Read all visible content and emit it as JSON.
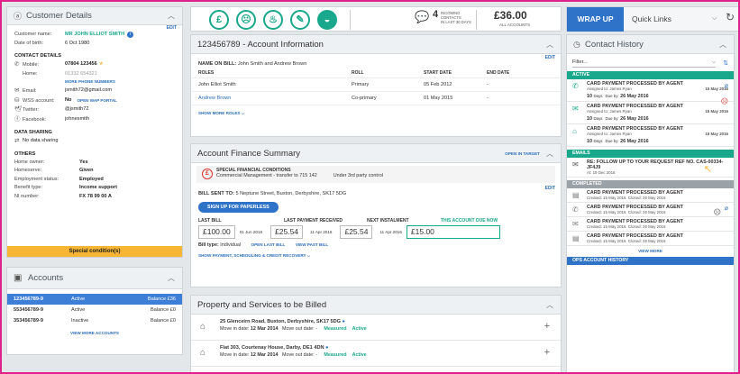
{
  "customer": {
    "title": "Customer Details",
    "edit": "EDIT",
    "name_label": "Customer name:",
    "name": "MR JOHN ELLIOT SMITH",
    "dob_label": "Date of birth:",
    "dob": "6 Oct 1980",
    "contact_title": "CONTACT DETAILS",
    "mobile_label": "Mobile:",
    "mobile": "07804 123456",
    "home_label": "Home:",
    "home": "01332 654321",
    "more_phone": "MORE PHONE NUMBERS",
    "email_label": "Email:",
    "email": "jsmith72@gmail.com",
    "wss_label": "WSS account:",
    "wss": "No",
    "wap_portal": "OPEN WAP PORTAL",
    "twitter_label": "Twitter:",
    "twitter": "@jsmith72",
    "facebook_label": "Facebook:",
    "facebook": "johnesmith",
    "sharing_title": "DATA SHARING",
    "sharing": "No data sharing",
    "others_title": "OTHERS",
    "homeowner_label": "Home owner:",
    "homeowner": "Yes",
    "homeserve_label": "Homeserve:",
    "homeserve": "Given",
    "employment_label": "Employment status:",
    "employment": "Employed",
    "benefit_label": "Benefit type:",
    "benefit": "Income support",
    "ni_label": "NI number:",
    "ni": "FX 78 99 00 A",
    "special": "Special condition(s)"
  },
  "accounts": {
    "title": "Accounts",
    "rows": [
      {
        "num": "123456789-9",
        "status": "Active",
        "balance": "Balance £36"
      },
      {
        "num": "553456789-9",
        "status": "Active",
        "balance": "Balance £0"
      },
      {
        "num": "353456789-9",
        "status": "Inactive",
        "balance": "Balance £0"
      }
    ],
    "view_more": "VIEW MORE ACCOUNTS"
  },
  "topbar": {
    "incoming_count": "4",
    "incoming_l1": "INCOMING",
    "incoming_l2": "CONTACTS",
    "incoming_l3": "IN LAST 30 DAYS",
    "amount": "£36.00",
    "amount_label": "ALL ACCOUNTS"
  },
  "wrap": {
    "wrap_up": "WRAP UP",
    "quick_links": "Quick Links"
  },
  "acct_info": {
    "title": "123456789 - Account Information",
    "edit": "EDIT",
    "name_on_bill_label": "NAME ON BILL:",
    "name_on_bill": "John Smith and Andrew Brown",
    "headers": [
      "ROLES",
      "ROLL",
      "START DATE",
      "END DATE"
    ],
    "rows": [
      [
        "John Elliot Smith",
        "Primary",
        "05 Feb 2012",
        "-"
      ],
      [
        "Andrew Brown",
        "Co-primary",
        "01 May 2015",
        "-"
      ]
    ],
    "show_more": "SHOW MORE ROLES"
  },
  "finance": {
    "title": "Account Finance Summary",
    "open_target": "OPEN IN TARGET",
    "special_title": "SPECIAL FINANCIAL CONDITIONS",
    "special_text": "Commercial Management - transfer to 715 142",
    "special_ctrl": "Under 3rd party control",
    "edit": "EDIT",
    "bill_sent_label": "BILL SENT TO:",
    "bill_sent": "5 Neptune Street, Buxton, Derbyshire, SK17 5DG",
    "paperless": "SIGN UP FOR PAPERLESS",
    "last_bill_label": "LAST BILL",
    "last_bill": "£100.00",
    "last_bill_date": "01 Jun 2016",
    "last_payment_label": "LAST PAYMENT RECEIVED",
    "last_payment": "£25.54",
    "last_payment_date": "11 Apr 2016",
    "next_label": "NEXT INSTALMENT",
    "next": "£25.54",
    "next_date": "11 Apr 2016",
    "due_label": "THIS ACCOUNT DUE NOW",
    "due": "£15.00",
    "bill_type_label": "Bill type:",
    "bill_type": "Individual",
    "open_last_bill": "OPEN LAST BILL",
    "view_past_bill": "VIEW PAST BILL",
    "show_payment": "SHOW PAYMENT, SCHEDULING & CREDIT RECOVERY"
  },
  "property": {
    "title": "Property and Services to be Billed",
    "rows": [
      {
        "addr": "25 Glenceirn Road, Buxton, Derbyshire, SK17 5DG",
        "movein_label": "Move in date:",
        "movein": "12 Mar 2014",
        "moveout_label": "Move out date:",
        "moveout": "-",
        "measured": "Measured",
        "active": "Active"
      },
      {
        "addr": "Flat 303, Courtenay House, Darby, DE1 4DN",
        "movein_label": "Move in date:",
        "movein": "12 Mar 2014",
        "moveout_label": "Move out date:",
        "moveout": "-",
        "measured": "Measured",
        "active": "Active"
      }
    ]
  },
  "history": {
    "title": "Contact History",
    "filter": "Filter...",
    "active_label": "ACTIVE",
    "active_items": [
      {
        "title": "CARD PAYMENT PROCESSED BY AGENT",
        "assigned": "Assigned to: James Ryan",
        "date": "15 May 2016",
        "days": "10",
        "days_label": "Days",
        "due_label": "Due by:",
        "due": "26 May 2016"
      },
      {
        "title": "CARD PAYMENT PROCESSED BY AGENT",
        "assigned": "Assigned to: James Ryan",
        "date": "15 May 2016",
        "days": "10",
        "days_label": "Days",
        "due_label": "Due by:",
        "due": "26 May 2016"
      },
      {
        "title": "CARD PAYMENT PROCESSED BY AGENT",
        "assigned": "Assigned to: James Ryan",
        "date": "15 May 2016",
        "days": "10",
        "days_label": "Days",
        "due_label": "Due by:",
        "due": "26 May 2016"
      }
    ],
    "emails_label": "EMAILS",
    "email_title": "RE: FOLLOW UP TO YOUR REQUEST REF NO. CAS-00334-JF4J9",
    "email_at": "At: 19 Dec 2016",
    "completed_label": "COMPLETED",
    "completed_items": [
      {
        "title": "CARD PAYMENT PROCESSED BY AGENT",
        "created": "Created: 15 May 2016",
        "closed": "Closed: 26 May 2016"
      },
      {
        "title": "CARD PAYMENT PROCESSED BY AGENT",
        "created": "Created: 15 May 2016",
        "closed": "Closed: 26 May 2016"
      },
      {
        "title": "CARD PAYMENT PROCESSED BY AGENT",
        "created": "Created: 15 May 2016",
        "closed": "Closed: 26 May 2016"
      },
      {
        "title": "CARD PAYMENT PROCESSED BY AGENT",
        "created": "Created: 15 May 2016",
        "closed": "Closed: 26 May 2016"
      }
    ],
    "view_more": "VIEW MORE",
    "ops_label": "OPS ACCOUNT HISTORY"
  },
  "colors": {
    "accent": "#2f73c8",
    "teal": "#19a88b",
    "special": "#f6b533",
    "frame": "#e0218a"
  }
}
